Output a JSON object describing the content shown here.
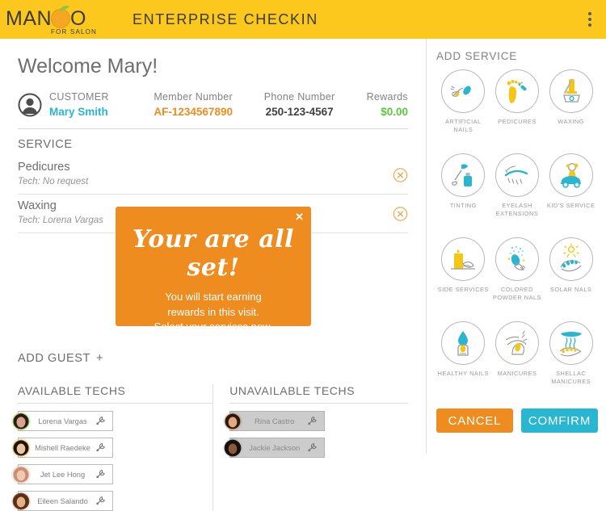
{
  "header": {
    "logo_main": "MANGO",
    "logo_sub": "FOR SALON",
    "title": "ENTERPRISE CHECKIN",
    "menu_icon": "overflow-menu-icon"
  },
  "welcome": "Welcome Mary!",
  "customer": {
    "avatar_icon": "user-avatar-icon",
    "fields": [
      {
        "label": "CUSTOMER",
        "value": "Mary Smith"
      },
      {
        "label": "Member Number",
        "value": "AF-1234567890"
      },
      {
        "label": "Phone Number",
        "value": "250-123-4567"
      },
      {
        "label": "Rewards",
        "value": "$0.00"
      }
    ]
  },
  "service_section": {
    "heading": "SERVICE",
    "rows": [
      {
        "name": "Pedicures",
        "tech": "Tech: No request",
        "delete_icon": "remove-circle-icon"
      },
      {
        "name": "Waxing",
        "tech": "Tech: Lorena Vargas",
        "delete_icon": "remove-circle-icon"
      }
    ]
  },
  "modal": {
    "title": "Your are all set!",
    "line1": "You will start earning",
    "line2": "rewards in this visit.",
    "line3": "Select your services now.",
    "close_icon": "close-icon"
  },
  "add_guest": {
    "label": "ADD GUEST",
    "plus_icon": "plus-icon"
  },
  "techs": {
    "available_heading": "AVAILABLE TECHS",
    "unavailable_heading": "UNAVAILABLE TECHS",
    "available": [
      {
        "name": "Lorena Vargas",
        "face": "#d8a48f",
        "hair": "#2b1a12",
        "ring": "#8cc63f"
      },
      {
        "name": "Mishell Raedeke",
        "face": "#e8c4a0",
        "hair": "#1c1008",
        "ring": "#e0b23a"
      },
      {
        "name": "Jet Lee Hong",
        "face": "#f0c8b4",
        "hair": "#c98f6e",
        "ring": "#f2c9c2"
      },
      {
        "name": "Eileen Salando",
        "face": "#e5b188",
        "hair": "#5a2d17",
        "ring": "#8a4a22"
      }
    ],
    "unavailable": [
      {
        "name": "Rina Castro",
        "face": "#e4a97f",
        "hair": "#2a1a10",
        "ring": "#cfa07a"
      },
      {
        "name": "Jackie Jackson",
        "face": "#8b5a3c",
        "hair": "#14100e",
        "ring": "#241c18"
      }
    ],
    "tool_icon": "wrench-icon"
  },
  "add_service": {
    "heading": "ADD SERVICE",
    "items": [
      {
        "label": "ARTIFICIAL NAILS",
        "icon": "artificial-nails-icon"
      },
      {
        "label": "PEDICURES",
        "icon": "pedicures-icon"
      },
      {
        "label": "WAXING",
        "icon": "waxing-icon"
      },
      {
        "label": "TINTING",
        "icon": "tinting-icon"
      },
      {
        "label": "EYELASH EXTENSIONS",
        "icon": "eyelash-extensions-icon"
      },
      {
        "label": "KID'S SERVICE",
        "icon": "kids-service-icon"
      },
      {
        "label": "SIDE SERVICES",
        "icon": "side-services-icon"
      },
      {
        "label": "COLORED POWDER NALS",
        "icon": "colored-powder-nails-icon"
      },
      {
        "label": "SOLAR NALS",
        "icon": "solar-nails-icon"
      },
      {
        "label": "HEALTHY NAILS",
        "icon": "healthy-nails-icon"
      },
      {
        "label": "MANICURES",
        "icon": "manicures-icon"
      },
      {
        "label": "SHELLAC MANICURES",
        "icon": "shellac-manicures-icon"
      }
    ]
  },
  "actions": {
    "cancel": "CANCEL",
    "confirm": "COMFIRM"
  },
  "colors": {
    "brand_yellow": "#FCC81E",
    "accent_orange": "#EE8C20",
    "accent_cyan": "#29B6D0",
    "rewards_green": "#5CC63E",
    "icon_yellow": "#F5C518"
  }
}
